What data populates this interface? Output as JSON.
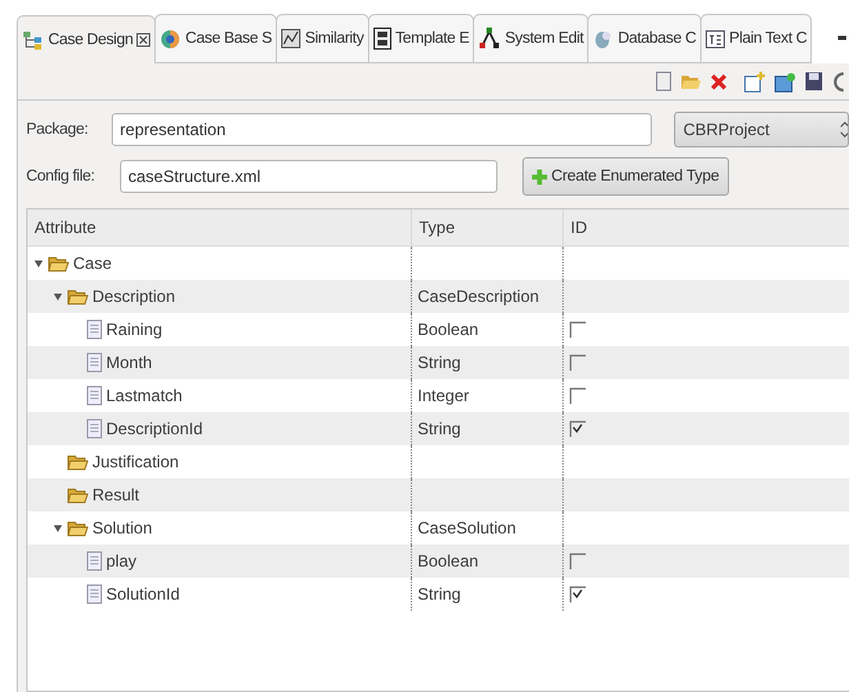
{
  "tabs": [
    {
      "label": "Case Design",
      "selected": true
    },
    {
      "label": "Case Base S",
      "selected": false
    },
    {
      "label": "Similarity",
      "selected": false
    },
    {
      "label": "Template E",
      "selected": false
    },
    {
      "label": "System Edit",
      "selected": false
    },
    {
      "label": "Database C",
      "selected": false
    },
    {
      "label": "Plain Text C",
      "selected": false
    }
  ],
  "form": {
    "package_label": "Package:",
    "package_value": "representation",
    "project": "CBRProject",
    "config_label": "Config file:",
    "config_value": "caseStructure.xml",
    "create_button": "Create Enumerated Type"
  },
  "table": {
    "columns": [
      "Attribute",
      "Type",
      "ID"
    ],
    "rows": [
      {
        "name": "Case",
        "kind": "folder",
        "expanded": true,
        "children": [
          {
            "name": "Description",
            "kind": "folder",
            "expanded": true,
            "type": "CaseDescription",
            "children": [
              {
                "name": "Raining",
                "kind": "field",
                "type": "Boolean",
                "checked": false
              },
              {
                "name": "Month",
                "kind": "field",
                "type": "String",
                "checked": false
              },
              {
                "name": "Lastmatch",
                "kind": "field",
                "type": "Integer",
                "checked": false
              },
              {
                "name": "DescriptionId",
                "kind": "field",
                "type": "String",
                "checked": true
              }
            ]
          },
          {
            "name": "Justification",
            "kind": "folder"
          },
          {
            "name": "Result",
            "kind": "folder"
          },
          {
            "name": "Solution",
            "kind": "folder",
            "expanded": true,
            "type": "CaseSolution",
            "children": [
              {
                "name": "play",
                "kind": "field",
                "type": "Boolean",
                "checked": false
              },
              {
                "name": "SolutionId",
                "kind": "field",
                "type": "String",
                "checked": true
              }
            ]
          }
        ]
      }
    ]
  }
}
